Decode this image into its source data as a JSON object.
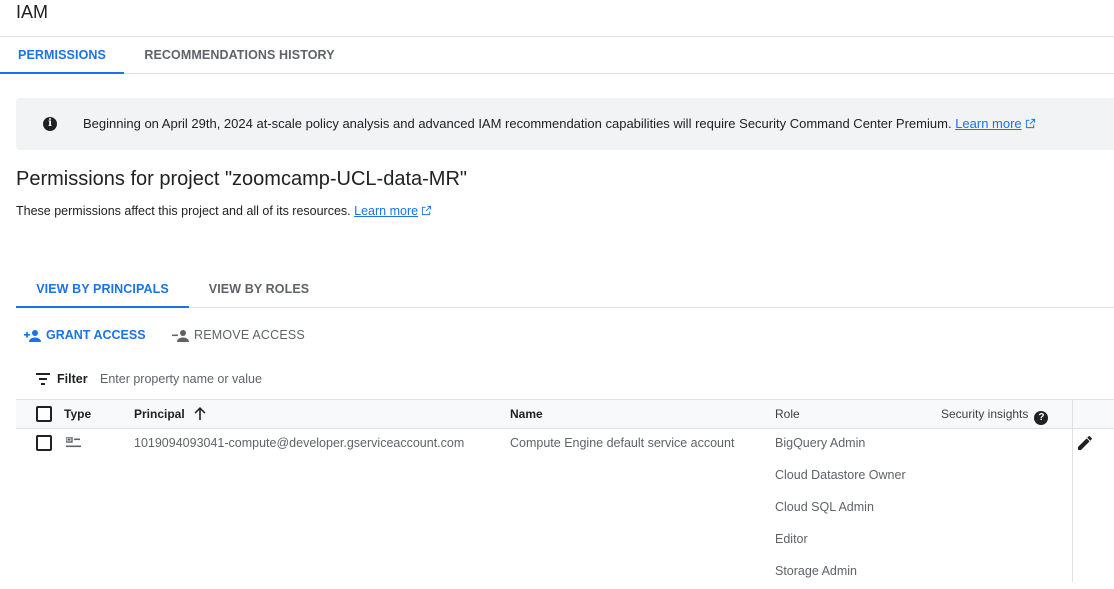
{
  "app": {
    "title": "IAM"
  },
  "top_tabs": [
    {
      "label": "PERMISSIONS",
      "active": true
    },
    {
      "label": "RECOMMENDATIONS HISTORY",
      "active": false
    }
  ],
  "banner": {
    "icon": "info-icon",
    "text": "Beginning on April 29th, 2024 at-scale policy analysis and advanced IAM recommendation capabilities will require Security Command Center Premium.",
    "link": "Learn more"
  },
  "section": {
    "title": "Permissions for project \"zoomcamp-UCL-data-MR\"",
    "subtitle": "These permissions affect this project and all of its resources.",
    "link": "Learn more"
  },
  "view_tabs": [
    {
      "label": "VIEW BY PRINCIPALS",
      "active": true
    },
    {
      "label": "VIEW BY ROLES",
      "active": false
    }
  ],
  "actions": {
    "grant": "GRANT ACCESS",
    "remove": "REMOVE ACCESS"
  },
  "filter": {
    "label": "Filter",
    "placeholder": "Enter property name or value"
  },
  "table": {
    "headers": {
      "type": "Type",
      "principal": "Principal",
      "name": "Name",
      "role": "Role",
      "security": "Security insights"
    },
    "rows": [
      {
        "type_icon": "service-account-icon",
        "principal": "1019094093041-compute@developer.gserviceaccount.com",
        "name": "Compute Engine default service account",
        "roles": [
          "BigQuery Admin",
          "Cloud Datastore Owner",
          "Cloud SQL Admin",
          "Editor",
          "Storage Admin"
        ]
      }
    ]
  },
  "colors": {
    "accent": "#1a73e8",
    "text": "#202124",
    "muted": "#5f6368",
    "banner_bg": "#f1f3f4"
  }
}
